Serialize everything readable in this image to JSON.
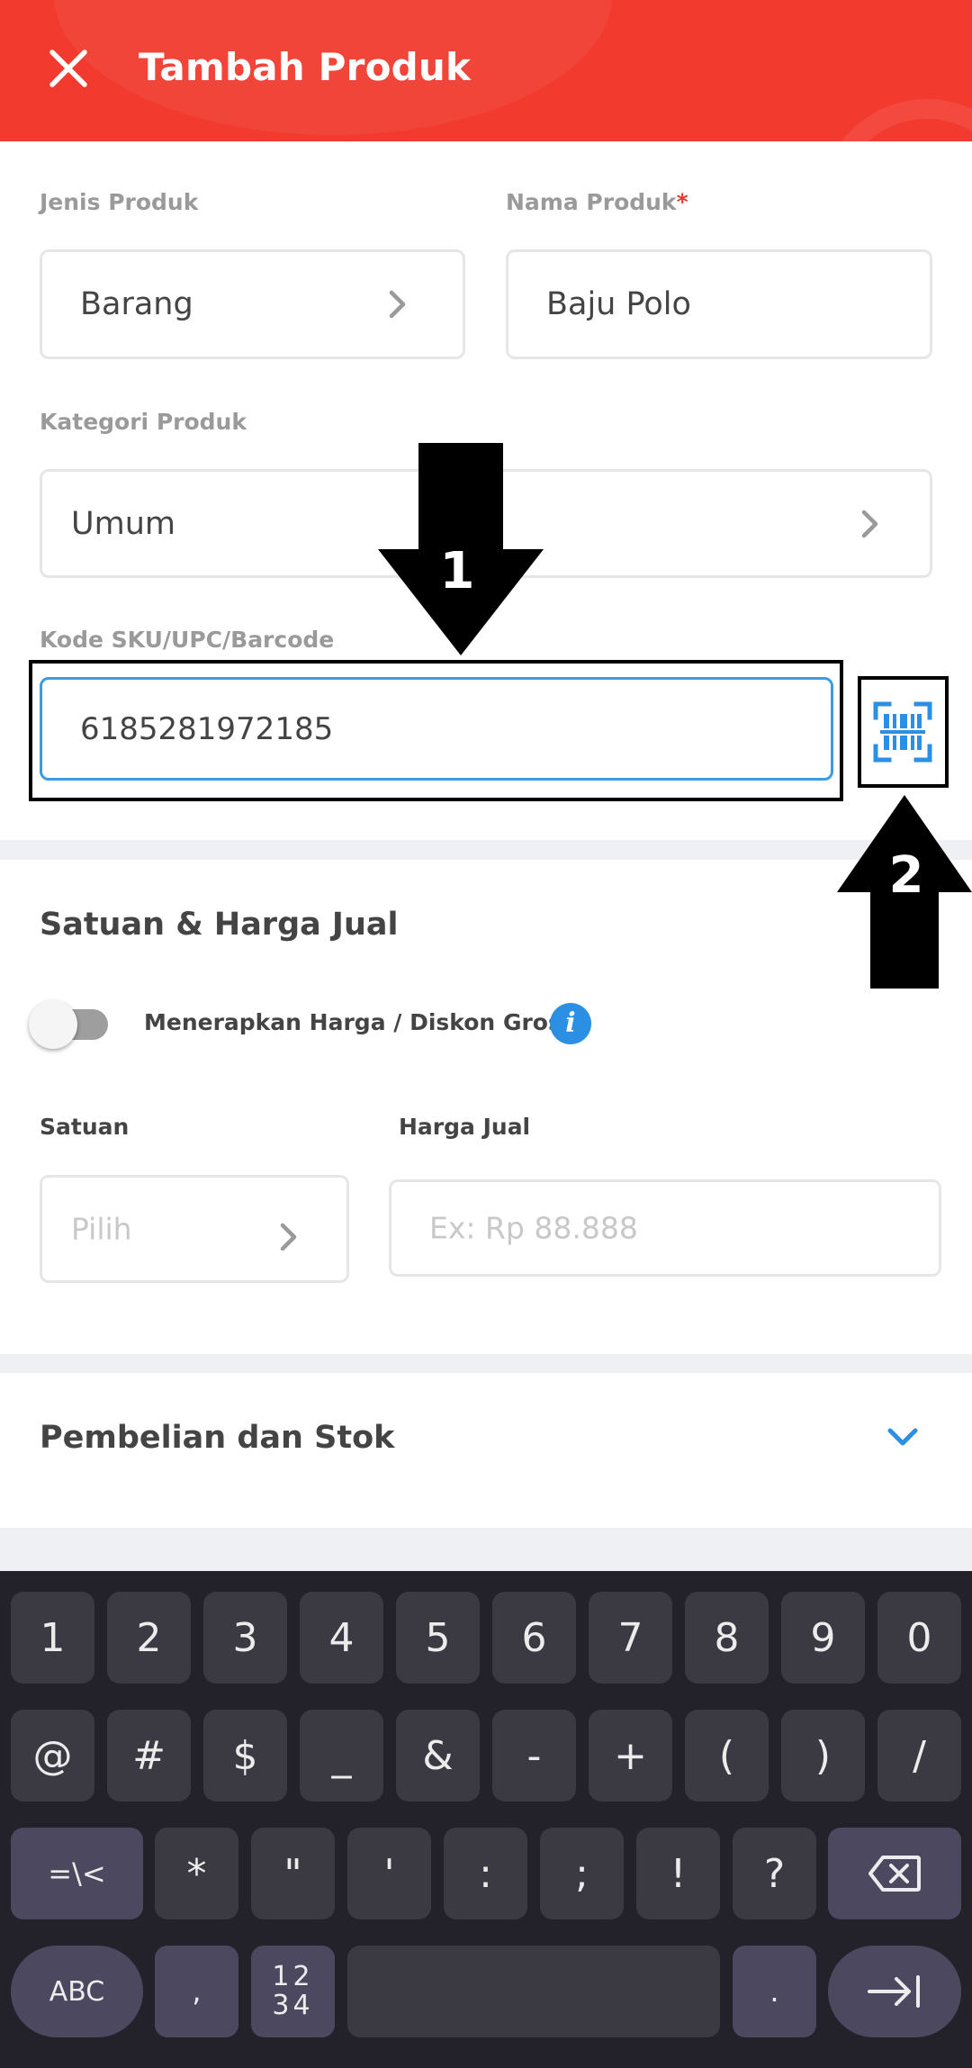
{
  "header": {
    "title": "Tambah Produk"
  },
  "form": {
    "jenis": {
      "label": "Jenis Produk",
      "value": "Barang"
    },
    "nama": {
      "label": "Nama Produk",
      "required_mark": "*",
      "value": "Baju Polo"
    },
    "kategori": {
      "label": "Kategori Produk",
      "value": "Umum"
    },
    "sku": {
      "label": "Kode SKU/UPC/Barcode",
      "value": "6185281972185"
    }
  },
  "satuan_section": {
    "title": "Satuan & Harga Jual",
    "toggle_label": "Menerapkan Harga / Diskon Grosir",
    "info_glyph": "i",
    "satuan": {
      "label": "Satuan",
      "placeholder": "Pilih"
    },
    "harga": {
      "label": "Harga Jual",
      "placeholder": "Ex: Rp 88.888"
    }
  },
  "pembelian_section": {
    "title": "Pembelian dan Stok"
  },
  "annotations": {
    "arrow1": "1",
    "arrow2": "2"
  },
  "keyboard": {
    "row1": [
      "1",
      "2",
      "3",
      "4",
      "5",
      "6",
      "7",
      "8",
      "9",
      "0"
    ],
    "row2": [
      "@",
      "#",
      "$",
      "_",
      "&",
      "-",
      "+",
      "(",
      ")",
      "/"
    ],
    "row3": [
      "=\\<",
      "*",
      "\"",
      "'",
      ":",
      ";",
      "!",
      "?"
    ],
    "row4": {
      "abc": "ABC",
      "comma": ",",
      "numpad_top": "12",
      "numpad_bottom": "34",
      "period": "."
    }
  },
  "colors": {
    "brand": "#f23a2e",
    "accent_blue": "#3d9be0"
  }
}
